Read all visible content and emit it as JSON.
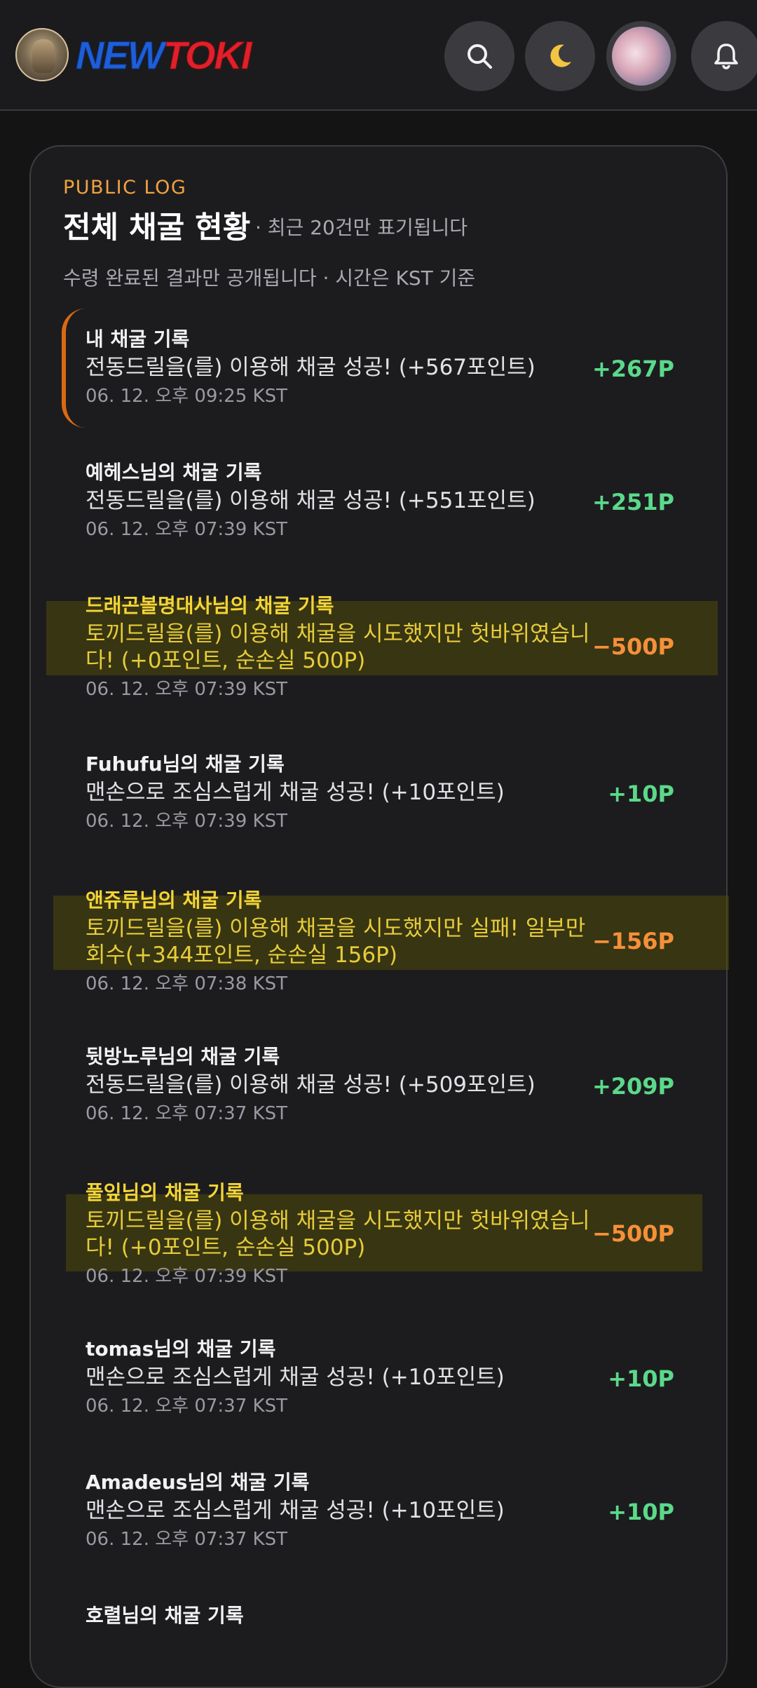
{
  "header": {
    "logo_part1": "NEW",
    "logo_part2": "TOKI",
    "icons": [
      "search-icon",
      "moon-icon",
      "profile-avatar",
      "bell-icon"
    ],
    "colors": {
      "logo_blue": "#1e5fd8",
      "logo_red": "#e0202a"
    }
  },
  "log": {
    "eyebrow": "PUBLIC LOG",
    "title": "전체 채굴 현황",
    "title_note": "· 최근 20건만 표기됩니다",
    "subtitle": "수령 완료된 결과만 공개됩니다 · 시간은 KST 기준",
    "entries": [
      {
        "who": "내 채굴 기록",
        "msg": "전동드릴을(를) 이용해 채굴 성공! (+567포인트)",
        "time": "06. 12. 오후 09:25 KST",
        "points": "+267P"
      },
      {
        "who": "예헤스님의 채굴 기록",
        "msg": "전동드릴을(를) 이용해 채굴 성공! (+551포인트)",
        "time": "06. 12. 오후 07:39 KST",
        "points": "+251P"
      },
      {
        "who": "드래곤볼명대사님의 채굴 기록",
        "msg": "토끼드릴을(를) 이용해 채굴을 시도했지만 헛바위였습니다! (+0포인트, 순손실 500P)",
        "time": "06. 12. 오후 07:39 KST",
        "points": "−500P"
      },
      {
        "who": "Fuhufu님의 채굴 기록",
        "msg": "맨손으로 조심스럽게 채굴 성공! (+10포인트)",
        "time": "06. 12. 오후 07:39 KST",
        "points": "+10P"
      },
      {
        "who": "앤쥬류님의 채굴 기록",
        "msg": "토끼드릴을(를) 이용해 채굴을 시도했지만 실패! 일부만 회수(+344포인트, 순손실 156P)",
        "time": "06. 12. 오후 07:38 KST",
        "points": "−156P"
      },
      {
        "who": "뒷방노루님의 채굴 기록",
        "msg": "전동드릴을(를) 이용해 채굴 성공! (+509포인트)",
        "time": "06. 12. 오후 07:37 KST",
        "points": "+209P"
      },
      {
        "who": "풀잎님의 채굴 기록",
        "msg": "토끼드릴을(를) 이용해 채굴을 시도했지만 헛바위였습니다! (+0포인트, 순손실 500P)",
        "time": "06. 12. 오후 07:39 KST",
        "points": "−500P"
      },
      {
        "who": "tomas님의 채굴 기록",
        "msg": "맨손으로 조심스럽게 채굴 성공! (+10포인트)",
        "time": "06. 12. 오후 07:37 KST",
        "points": "+10P"
      },
      {
        "who": "Amadeus님의 채굴 기록",
        "msg": "맨손으로 조심스럽게 채굴 성공! (+10포인트)",
        "time": "06. 12. 오후 07:37 KST",
        "points": "+10P"
      },
      {
        "who": "호렬님의 채굴 기록",
        "msg": "",
        "time": "",
        "points": ""
      }
    ]
  },
  "colors": {
    "positive": "#5bd98a",
    "negative": "#f5903a",
    "accent": "#f0a240",
    "warning_text": "#f3d536"
  }
}
